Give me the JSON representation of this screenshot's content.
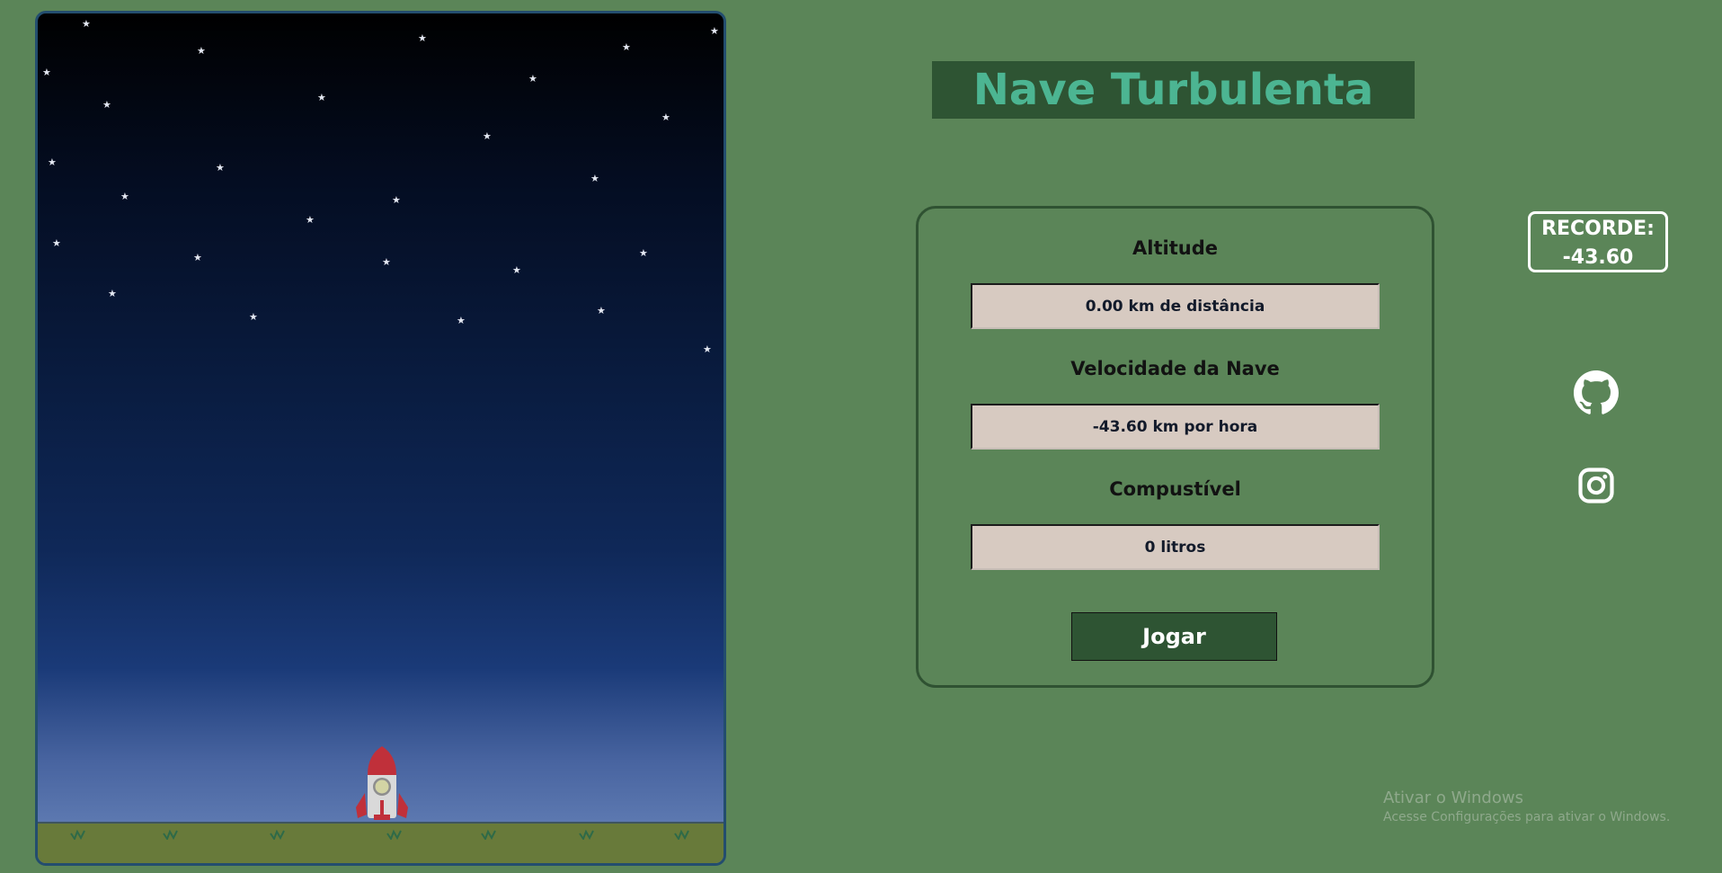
{
  "game": {
    "title": "Nave Turbulenta",
    "record_label": "RECORDE:",
    "record_value": "-43.60"
  },
  "panel": {
    "altitude_label": "Altitude",
    "altitude_value": "0.00 km de distância",
    "speed_label": "Velocidade da Nave",
    "speed_value": "-43.60 km por hora",
    "fuel_label": "Compustível",
    "fuel_value": "0 litros",
    "play_label": "Jogar"
  },
  "social": {
    "github_icon": "github-icon",
    "instagram_icon": "instagram-icon"
  },
  "watermark": {
    "line1": "Ativar o Windows",
    "line2": "Acesse Configurações para ativar o Windows."
  },
  "colors": {
    "background": "#5b8558",
    "accent_dark": "#2e5433",
    "title_text": "#4cb592",
    "field_bg": "#d7cac1",
    "rocket_red": "#c0303a"
  }
}
